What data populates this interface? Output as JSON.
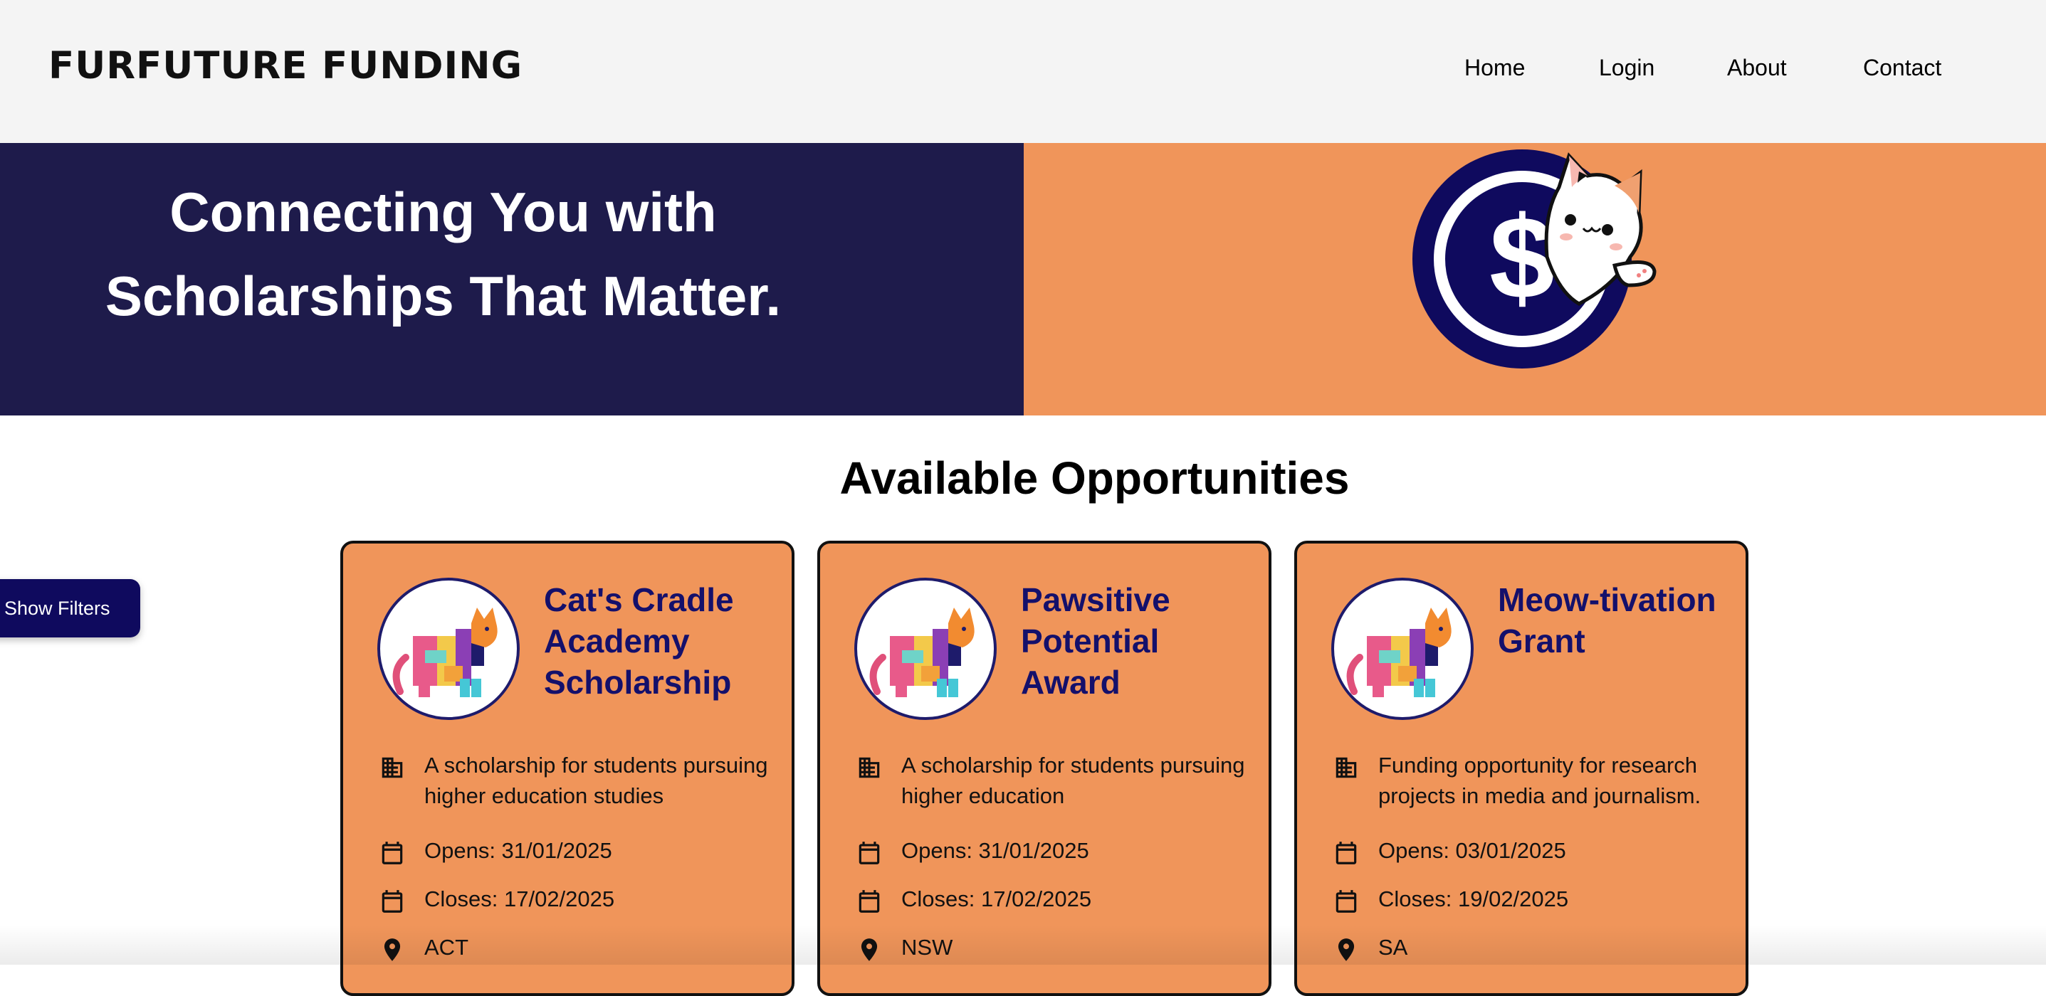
{
  "brand": {
    "logo_text": "FURFUTURE FUNDING"
  },
  "nav": {
    "home": "Home",
    "login": "Login",
    "about": "About",
    "contact": "Contact"
  },
  "hero": {
    "line1": "Connecting You with",
    "line2": "Scholarships That Matter.",
    "left_color": "#1e1b4b",
    "right_color": "#f0955a"
  },
  "section": {
    "title": "Available Opportunities"
  },
  "filters": {
    "button_label": "Show Filters"
  },
  "cards": [
    {
      "title": "Cat's Cradle Academy Scholarship",
      "description": "A scholarship for students pursuing higher education studies",
      "opens": "Opens: 31/01/2025",
      "closes": "Closes: 17/02/2025",
      "location": "ACT"
    },
    {
      "title": "Pawsitive Potential Award",
      "description": "A scholarship for students pursuing higher education",
      "opens": "Opens: 31/01/2025",
      "closes": "Closes: 17/02/2025",
      "location": "NSW"
    },
    {
      "title": "Meow-tivation Grant",
      "description": "Funding opportunity for research projects in media and journalism.",
      "opens": "Opens: 03/01/2025",
      "closes": "Closes: 19/02/2025",
      "location": "SA"
    }
  ],
  "icons": {
    "description": "building-icon",
    "opens": "calendar-icon",
    "closes": "calendar-icon",
    "location": "location-pin-icon",
    "card_avatar": "cat-illustration-icon",
    "hero": "cat-dollar-coin-icon"
  },
  "colors": {
    "accent_orange": "#f0955a",
    "navy": "#1e1b4b",
    "card_title": "#14106b",
    "filter_button": "#0f0a5e"
  }
}
